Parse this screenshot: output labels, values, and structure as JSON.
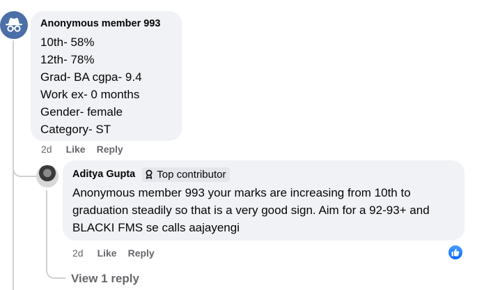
{
  "comment": {
    "author": "Anonymous member 993",
    "lines": [
      "10th- 58%",
      "12th- 78%",
      "Grad- BA cgpa- 9.4",
      "Work ex- 0 months",
      "Gender- female",
      "Category- ST"
    ],
    "time": "2d",
    "like_label": "Like",
    "reply_label": "Reply"
  },
  "reply": {
    "author": "Aditya Gupta",
    "badge": "Top contributor",
    "text": "Anonymous member 993 your marks are increasing from 10th to graduation steadily so that is a very good sign. Aim for a 92-93+ and BLACKI FMS se calls aajayengi",
    "time": "2d",
    "like_label": "Like",
    "reply_label": "Reply"
  },
  "view_replies": "View 1 reply",
  "colors": {
    "bubble": "#f0f2f5",
    "meta": "#65676b",
    "like_blue": "#0866ff",
    "anon_avatar": "#4b6fa6"
  },
  "icons": {
    "anon_avatar": "incognito-icon",
    "badge": "contributor-badge-icon",
    "reaction": "thumbs-up-icon"
  }
}
